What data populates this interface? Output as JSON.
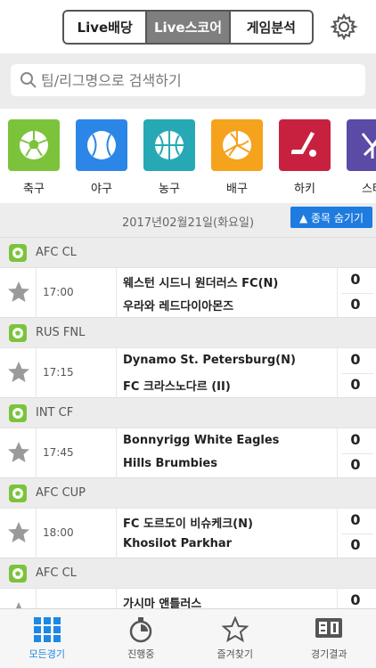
{
  "header": {
    "tabs": [
      {
        "label": "Live배당",
        "active": false
      },
      {
        "label": "Live스코어",
        "active": true
      },
      {
        "label": "게임분석",
        "active": false
      }
    ],
    "settings_icon": "gear-icon"
  },
  "search": {
    "placeholder": "팀/리그명으로 검색하기",
    "icon": "search-icon"
  },
  "sports": [
    {
      "label": "축구",
      "color": "#7cc33c",
      "icon": "soccer-ball-icon"
    },
    {
      "label": "야구",
      "color": "#2c86e8",
      "icon": "baseball-icon"
    },
    {
      "label": "농구",
      "color": "#26a9b5",
      "icon": "basketball-icon"
    },
    {
      "label": "배구",
      "color": "#f5a21d",
      "icon": "volleyball-icon"
    },
    {
      "label": "하키",
      "color": "#c8213f",
      "icon": "hockey-stick-icon"
    },
    {
      "label": "스타",
      "color": "#5b4aa6",
      "icon": "starcraft-icon"
    }
  ],
  "date_bar": {
    "date": "2017년02월21일(화요일)",
    "hide_button": "▲ 종목 숨기기"
  },
  "matches": [
    {
      "league": "AFC CL",
      "time": "17:00",
      "home": "웨스턴 시드니 원더러스 FC(N)",
      "away": "우라와 레드다이아몬즈",
      "home_score": "0",
      "away_score": "0"
    },
    {
      "league": "RUS FNL",
      "time": "17:15",
      "home": "Dynamo St. Petersburg(N)",
      "away": "FC 크라스노다르 (II)",
      "home_score": "0",
      "away_score": "0"
    },
    {
      "league": "INT CF",
      "time": "17:45",
      "home": "Bonnyrigg White Eagles",
      "away": "Hills Brumbies",
      "home_score": "0",
      "away_score": "0"
    },
    {
      "league": "AFC CUP",
      "time": "18:00",
      "home": "FC 도르도이 비슈케크(N)",
      "away": "Khosilot Parkhar",
      "home_score": "0",
      "away_score": "0"
    },
    {
      "league": "AFC CL",
      "time": "",
      "home": "가시마 앤틀러스",
      "away": "",
      "home_score": "0",
      "away_score": ""
    }
  ],
  "bottom_nav": [
    {
      "label": "모든경기",
      "icon": "grid-icon",
      "active": true
    },
    {
      "label": "진행중",
      "icon": "stopwatch-icon",
      "active": false
    },
    {
      "label": "즐겨찾기",
      "icon": "star-outline-icon",
      "active": false
    },
    {
      "label": "경기결과",
      "icon": "scoreboard-icon",
      "active": false
    }
  ],
  "colors": {
    "accent": "#1e7be0",
    "active_tab": "#7f7f7f",
    "league_bg": "#ececec"
  }
}
